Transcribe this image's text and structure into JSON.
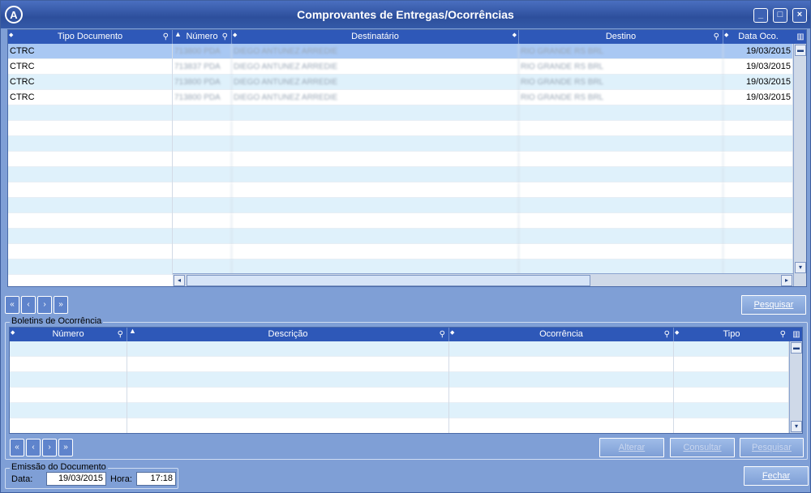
{
  "window": {
    "title": "Comprovantes de Entregas/Ocorrências",
    "logo": "A",
    "buttons": {
      "minimize": "_",
      "maximize": "□",
      "close": "×"
    }
  },
  "colors": {
    "title_bar": "#2d4f9c",
    "header": "#2e58b8",
    "selected_row": "#a9c8f3",
    "alt_row": "#dff1fb",
    "body": "#7f9fd6"
  },
  "top_grid": {
    "columns": [
      {
        "key": "tipo",
        "label": "Tipo Documento"
      },
      {
        "key": "numero",
        "label": "Número"
      },
      {
        "key": "dest",
        "label": "Destinatário"
      },
      {
        "key": "destino",
        "label": "Destino"
      },
      {
        "key": "data",
        "label": "Data Oco."
      }
    ],
    "rows": [
      {
        "tipo": "CTRC",
        "numero": "713800 PDA",
        "dest": "DIEGO ANTUNEZ ARREDIE",
        "destino": "RIO GRANDE RS BRL",
        "data": "19/03/2015"
      },
      {
        "tipo": "CTRC",
        "numero": "713837 PDA",
        "dest": "DIEGO ANTUNEZ ARREDIE",
        "destino": "RIO GRANDE RS BRL",
        "data": "19/03/2015"
      },
      {
        "tipo": "CTRC",
        "numero": "713800 PDA",
        "dest": "DIEGO ANTUNEZ ARREDIE",
        "destino": "RIO GRANDE RS BRL",
        "data": "19/03/2015"
      },
      {
        "tipo": "CTRC",
        "numero": "713800 PDA",
        "dest": "DIEGO ANTUNEZ ARREDIE",
        "destino": "RIO GRANDE RS BRL",
        "data": "19/03/2015"
      }
    ],
    "selected_index": 0
  },
  "top_nav": {
    "first": "«",
    "prev": "‹",
    "next": "›",
    "last": "»"
  },
  "pesquisar_top": "Pesquisar",
  "boletins": {
    "label": "Boletins de Ocorrência",
    "columns": [
      {
        "key": "numero",
        "label": "Número"
      },
      {
        "key": "descricao",
        "label": "Descrição"
      },
      {
        "key": "ocorrencia",
        "label": "Ocorrência"
      },
      {
        "key": "tipo",
        "label": "Tipo"
      }
    ],
    "rows": []
  },
  "bottom_buttons": {
    "alterar": "Alterar",
    "consultar": "Consultar",
    "pesquisar": "Pesquisar",
    "fechar": "Fechar"
  },
  "emissao": {
    "label": "Emissão do Documento",
    "data_label": "Data:",
    "data_value": "19/03/2015",
    "hora_label": "Hora:",
    "hora_value": "17:18"
  }
}
